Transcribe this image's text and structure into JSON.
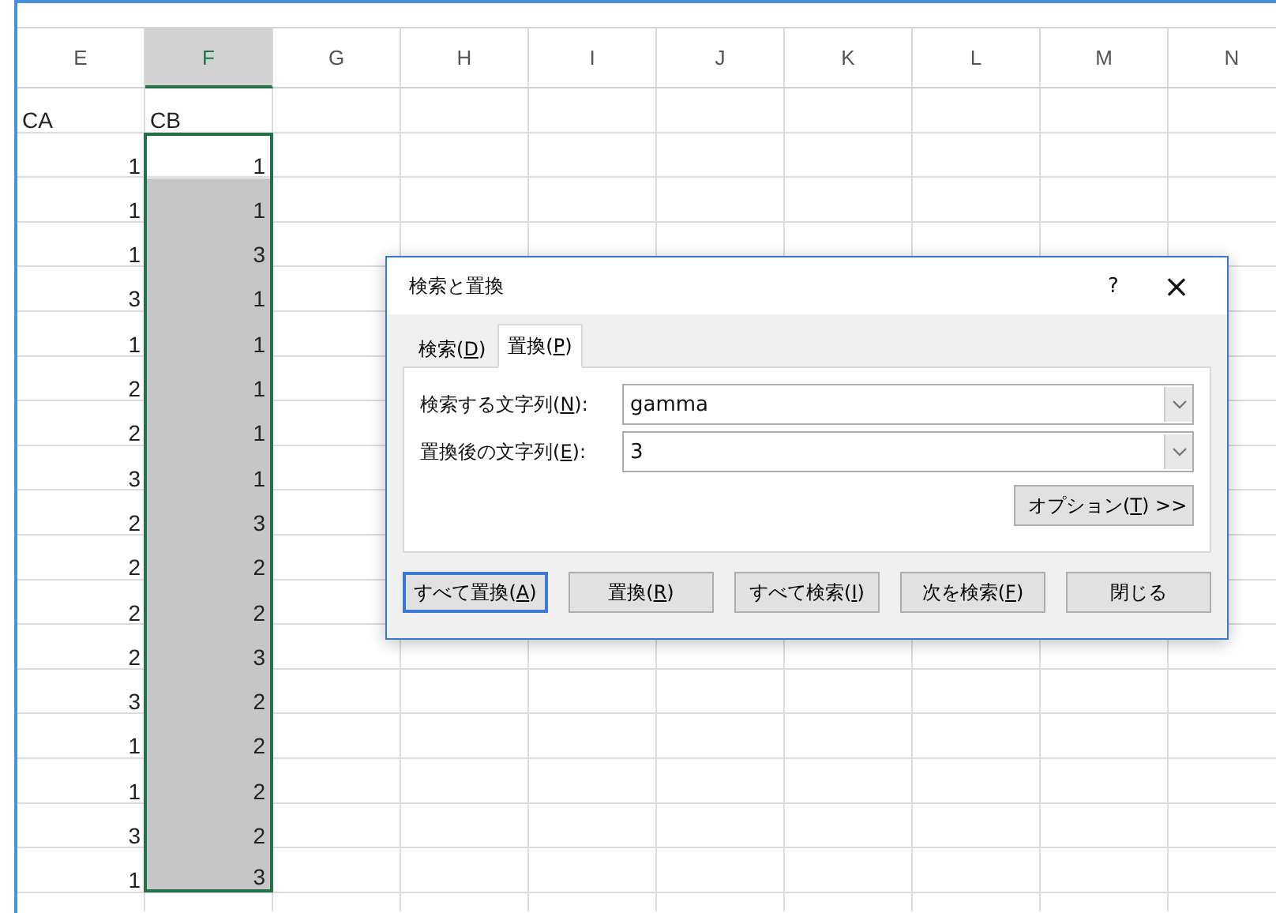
{
  "columns": [
    {
      "label": "E",
      "selected": false
    },
    {
      "label": "F",
      "selected": true
    },
    {
      "label": "G",
      "selected": false
    },
    {
      "label": "H",
      "selected": false
    },
    {
      "label": "I",
      "selected": false
    },
    {
      "label": "J",
      "selected": false
    },
    {
      "label": "K",
      "selected": false
    },
    {
      "label": "L",
      "selected": false
    },
    {
      "label": "M",
      "selected": false
    },
    {
      "label": "N",
      "selected": false
    }
  ],
  "header_row": [
    "CA",
    "CB"
  ],
  "rows": [
    {
      "cells": [
        "1",
        "1"
      ],
      "selected": true,
      "active": true
    },
    {
      "cells": [
        "1",
        "1"
      ],
      "selected": true,
      "active": false
    },
    {
      "cells": [
        "1",
        "3"
      ],
      "selected": true,
      "active": false
    },
    {
      "cells": [
        "3",
        "1"
      ],
      "selected": true,
      "active": false
    },
    {
      "cells": [
        "1",
        "1"
      ],
      "selected": true,
      "active": false
    },
    {
      "cells": [
        "2",
        "1"
      ],
      "selected": true,
      "active": false
    },
    {
      "cells": [
        "2",
        "1"
      ],
      "selected": true,
      "active": false
    },
    {
      "cells": [
        "3",
        "1"
      ],
      "selected": true,
      "active": false
    },
    {
      "cells": [
        "2",
        "3"
      ],
      "selected": true,
      "active": false
    },
    {
      "cells": [
        "2",
        "2"
      ],
      "selected": true,
      "active": false
    },
    {
      "cells": [
        "2",
        "2"
      ],
      "selected": true,
      "active": false
    },
    {
      "cells": [
        "2",
        "3"
      ],
      "selected": true,
      "active": false
    },
    {
      "cells": [
        "3",
        "2"
      ],
      "selected": true,
      "active": false
    },
    {
      "cells": [
        "1",
        "2"
      ],
      "selected": true,
      "active": false
    },
    {
      "cells": [
        "1",
        "2"
      ],
      "selected": true,
      "active": false
    },
    {
      "cells": [
        "3",
        "2"
      ],
      "selected": true,
      "active": false
    },
    {
      "cells": [
        "1",
        "3"
      ],
      "selected": true,
      "active": false
    }
  ],
  "dialog": {
    "title": "検索と置換",
    "help": "?",
    "close": "×",
    "tabs": [
      {
        "label": {
          "pre": "検索(",
          "key": "D",
          "post": ")"
        },
        "selected": false
      },
      {
        "label": {
          "pre": "置換(",
          "key": "P",
          "post": ")"
        },
        "selected": true
      }
    ],
    "fields": [
      {
        "label": {
          "pre": "検索する文字列(",
          "key": "N",
          "post": "):"
        },
        "value": "gamma"
      },
      {
        "label": {
          "pre": "置換後の文字列(",
          "key": "E",
          "post": "):"
        },
        "value": "3"
      }
    ],
    "options_button": {
      "pre": "オプション(",
      "key": "T",
      "post": ") >>"
    },
    "buttons": [
      {
        "label": {
          "pre": "すべて置換(",
          "key": "A",
          "post": ")"
        },
        "default": true
      },
      {
        "label": {
          "pre": "置換(",
          "key": "R",
          "post": ")"
        },
        "default": false
      },
      {
        "label": {
          "pre": "すべて検索(",
          "key": "I",
          "post": ")"
        },
        "default": false
      },
      {
        "label": {
          "pre": "次を検索(",
          "key": "F",
          "post": ")"
        },
        "default": false
      },
      {
        "label": {
          "pre": "閉じる"
        },
        "default": false
      }
    ]
  }
}
